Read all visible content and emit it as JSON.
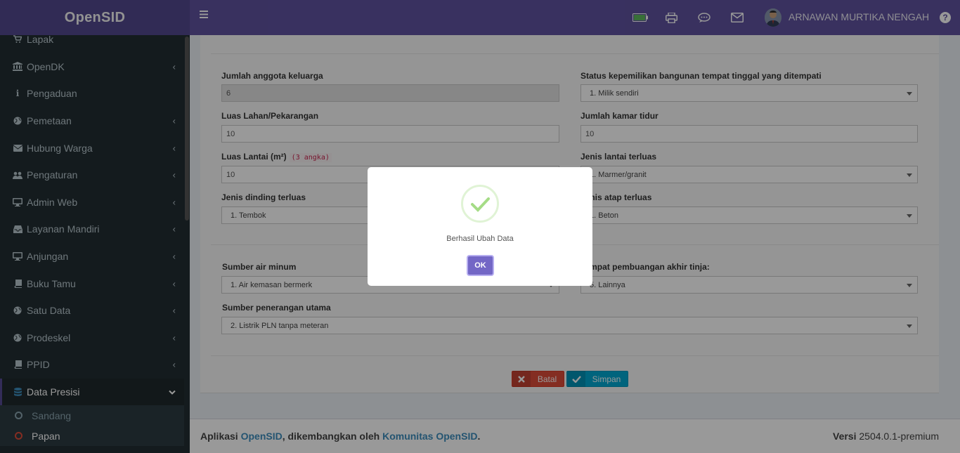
{
  "app": {
    "brand": "OpenSID"
  },
  "sidebar": {
    "items": [
      {
        "label": "Lapak",
        "icon": "cart-icon",
        "has_chevron": false
      },
      {
        "label": "OpenDK",
        "icon": "bank-icon",
        "has_chevron": true
      },
      {
        "label": "Pengaduan",
        "icon": "info-icon",
        "has_chevron": false
      },
      {
        "label": "Pemetaan",
        "icon": "globe-icon",
        "has_chevron": true
      },
      {
        "label": "Hubung Warga",
        "icon": "envelope-icon",
        "has_chevron": true
      },
      {
        "label": "Pengaturan",
        "icon": "users-icon",
        "has_chevron": true
      },
      {
        "label": "Admin Web",
        "icon": "desktop-icon",
        "has_chevron": true
      },
      {
        "label": "Layanan Mandiri",
        "icon": "inbox-icon",
        "has_chevron": true
      },
      {
        "label": "Anjungan",
        "icon": "desktop-icon",
        "has_chevron": true
      },
      {
        "label": "Buku Tamu",
        "icon": "book-icon",
        "has_chevron": true
      },
      {
        "label": "Satu Data",
        "icon": "globe-icon",
        "has_chevron": true
      },
      {
        "label": "Prodeskel",
        "icon": "globe-icon",
        "has_chevron": true
      },
      {
        "label": "PPID",
        "icon": "book-icon",
        "has_chevron": true
      },
      {
        "label": "Data Presisi",
        "icon": "database-icon",
        "has_chevron": true,
        "active": true
      }
    ],
    "submenu": [
      {
        "label": "Sandang",
        "current": false
      },
      {
        "label": "Papan",
        "current": true
      }
    ]
  },
  "header": {
    "user_name": "ARNAWAN MURTIKA NENGAH",
    "help": "?",
    "icons": [
      "battery-icon",
      "printer-icon",
      "comment-icon",
      "envelope-icon"
    ]
  },
  "form": {
    "left": [
      {
        "label": "Jumlah anggota keluarga",
        "value": "6",
        "readonly": true
      },
      {
        "label": "Luas Lahan/Pekarangan",
        "value": "10"
      },
      {
        "label": "Luas Lantai (m²)",
        "hint": "(3 angka)",
        "value": "10"
      },
      {
        "label": "Jenis dinding terluas",
        "value": "1. Tembok",
        "select": true
      }
    ],
    "right": [
      {
        "label": "Status kepemilikan bangunan tempat tinggal yang ditempati",
        "value": "1. Milik sendiri"
      },
      {
        "label": "Jumlah kamar tidur",
        "value": "10"
      },
      {
        "label": "Jenis lantai terluas",
        "value": "1. Marmer/granit"
      },
      {
        "label": "Jenis atap terluas",
        "value": "1. Beton"
      }
    ],
    "section2": {
      "air_label": "Sumber air minum",
      "air_value": "1. Air kemasan bermerk",
      "tinja_label": "Tempat pembuangan akhir tinja:",
      "tinja_value": "5. Lainnya",
      "penerangan_label": "Sumber penerangan utama",
      "penerangan_value": "2. Listrik PLN tanpa meteran"
    },
    "buttons": {
      "batal": "Batal",
      "simpan": "Simpan"
    }
  },
  "footer": {
    "prefix": "Aplikasi ",
    "app_link": "OpenSID",
    "middle": ", dikembangkan oleh ",
    "community_link": "Komunitas OpenSID",
    "suffix": ".",
    "version_label": "Versi",
    "version_value": "2504.0.1-premium"
  },
  "modal": {
    "message": "Berhasil Ubah Data",
    "ok_label": "OK",
    "icon": "success-check-icon"
  },
  "colors": {
    "header": "#5d4f9e",
    "sidebar": "#222d32",
    "danger": "#dd4b39",
    "info": "#00a7d0",
    "ok_button": "#7367c6",
    "success": "#a5dc86"
  }
}
